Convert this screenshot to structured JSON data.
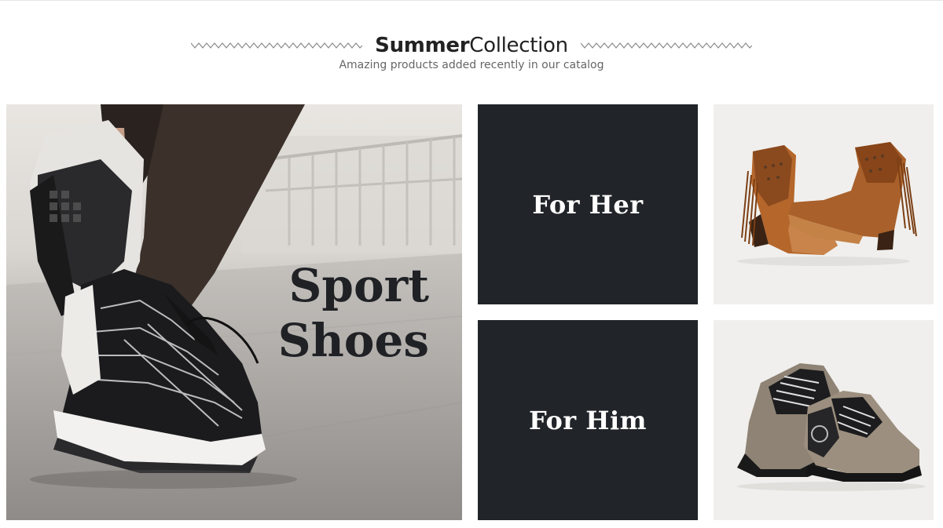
{
  "header": {
    "title_strong": "Summer",
    "title_light": "Collection",
    "subtitle": "Amazing products added recently in our catalog"
  },
  "tiles": {
    "sport": {
      "line1": "Sport",
      "line2": "Shoes",
      "image": "sneaker-running-photo"
    },
    "her": {
      "label": "For Her"
    },
    "him": {
      "label": "For Him"
    },
    "boots": {
      "image": "brown-fringe-boots-photo"
    },
    "sneakers": {
      "image": "metallic-lace-up-shoes-photo"
    }
  },
  "colors": {
    "dark_tile": "#212428",
    "light_tile": "#f0efed",
    "title_text": "#222222",
    "subtitle_text": "#666666"
  }
}
